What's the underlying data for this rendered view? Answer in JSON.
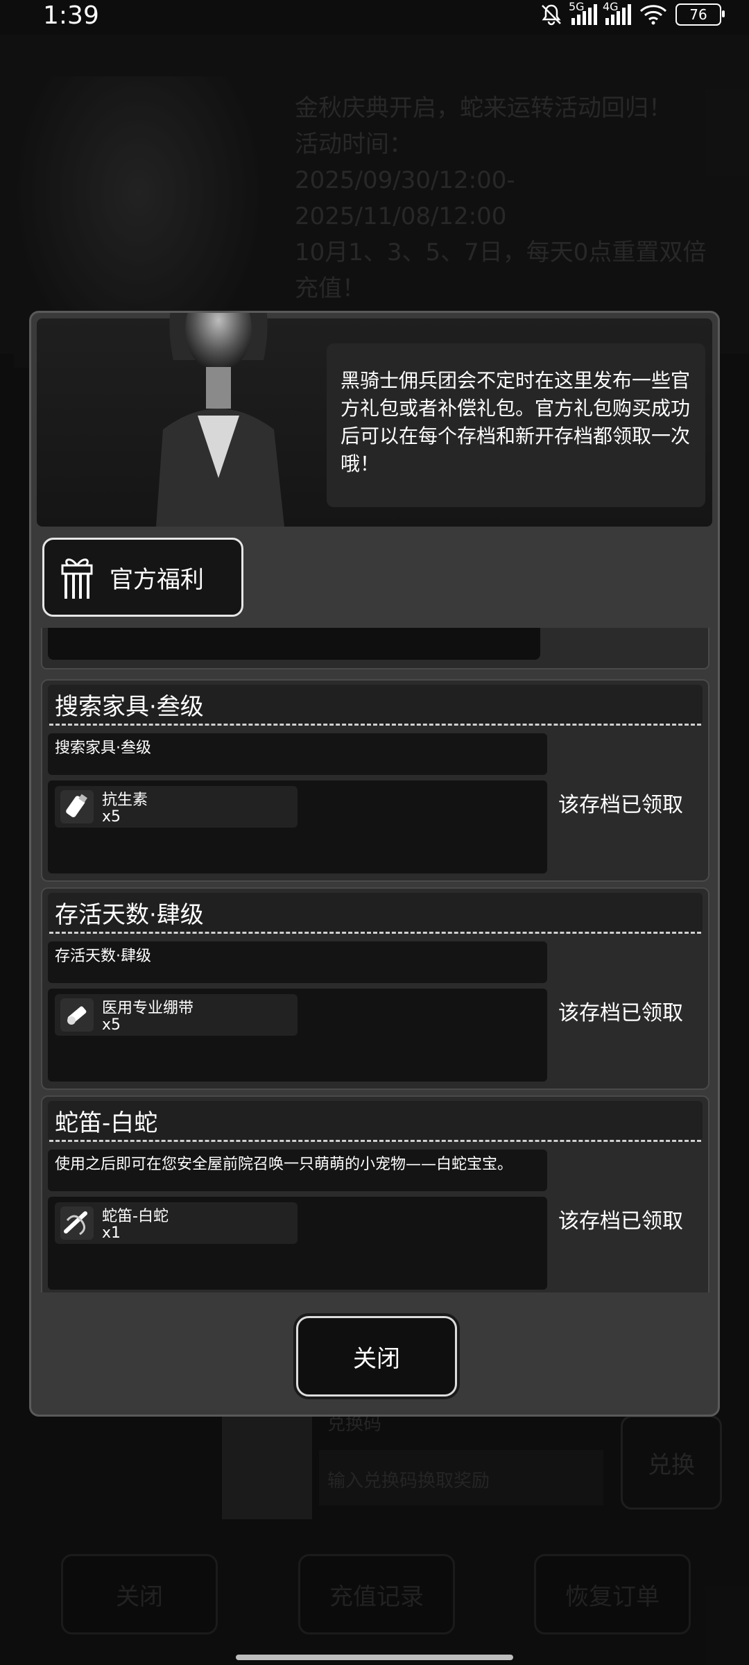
{
  "status_bar": {
    "time": "1:39",
    "sim1": "5G",
    "sim2": "4G",
    "battery": "76"
  },
  "background": {
    "announcement": "金秋庆典开启，蛇来运转活动回归！\n活动时间：\n2025/09/30/12:00-2025/11/08/12:00\n10月1、3、5、7日，每天0点重置双倍充值！",
    "redeem": {
      "field_label": "兑换码",
      "input_placeholder": "输入兑换码换取奖励",
      "button": "兑换"
    },
    "buttons": {
      "close": "关闭",
      "recharge_history": "充值记录",
      "restore_order": "恢复订单"
    }
  },
  "dialog": {
    "speech": "黑骑士佣兵团会不定时在这里发布一些官方礼包或者补偿礼包。官方礼包购买成功后可以在每个存档和新开存档都领取一次哦！",
    "tab_label": "官方福利",
    "cards": [
      {
        "title": "搜索家具·叁级",
        "desc": "搜索家具·叁级",
        "item_name": "抗生素",
        "item_qty": "x5",
        "item_icon": "antibiotic-icon",
        "status": "该存档已领取"
      },
      {
        "title": "存活天数·肆级",
        "desc": "存活天数·肆级",
        "item_name": "医用专业绷带",
        "item_qty": "x5",
        "item_icon": "bandage-icon",
        "status": "该存档已领取"
      },
      {
        "title": "蛇笛-白蛇",
        "desc": "使用之后即可在您安全屋前院召唤一只萌萌的小宠物——白蛇宝宝。",
        "item_name": "蛇笛-白蛇",
        "item_qty": "x1",
        "item_icon": "snake-flute-icon",
        "status": "该存档已领取"
      }
    ],
    "close_label": "关闭"
  }
}
